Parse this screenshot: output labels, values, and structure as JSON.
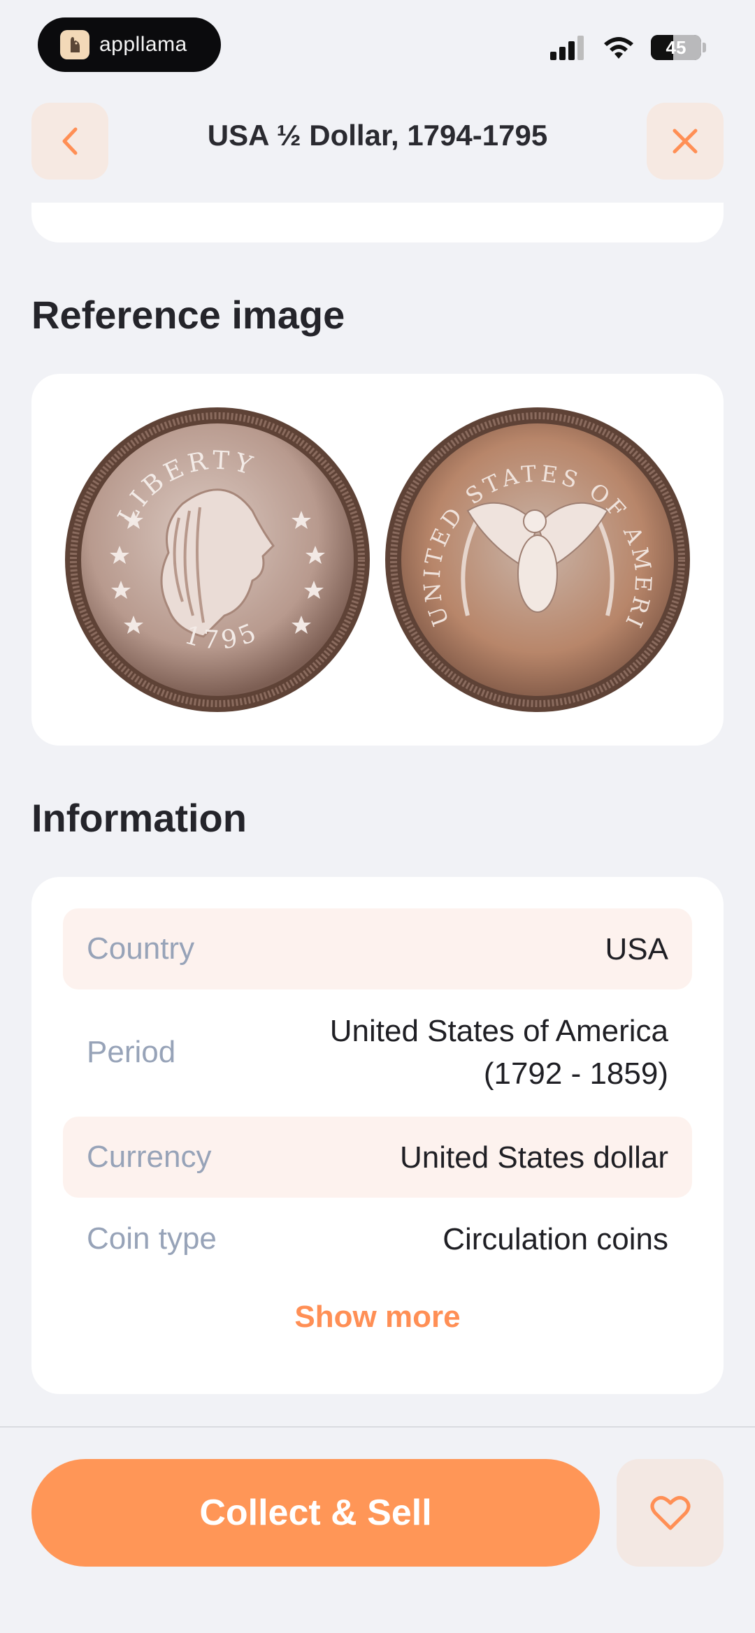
{
  "status_bar": {
    "brand": "appllama",
    "battery": "45"
  },
  "header": {
    "title": "USA ½ Dollar, 1794-1795"
  },
  "reference": {
    "heading": "Reference image",
    "obverse_legend": "LIBERTY",
    "obverse_date": "1795",
    "reverse_legend": "UNITED STATES OF AMERICA"
  },
  "information": {
    "heading": "Information",
    "rows": [
      {
        "key": "Country",
        "value": "USA"
      },
      {
        "key": "Period",
        "value_line1": "United States of America",
        "value_line2": "(1792 - 1859)"
      },
      {
        "key": "Currency",
        "value": "United States dollar"
      },
      {
        "key": "Coin type",
        "value": "Circulation coins"
      }
    ],
    "show_more": "Show more"
  },
  "footer": {
    "cta": "Collect & Sell"
  },
  "colors": {
    "accent": "#ff9657",
    "link": "#ff8f55",
    "background": "#f1f2f6"
  },
  "icons": [
    "back-arrow-icon",
    "close-icon",
    "heart-icon",
    "signal-icon",
    "wifi-icon",
    "battery-icon"
  ]
}
